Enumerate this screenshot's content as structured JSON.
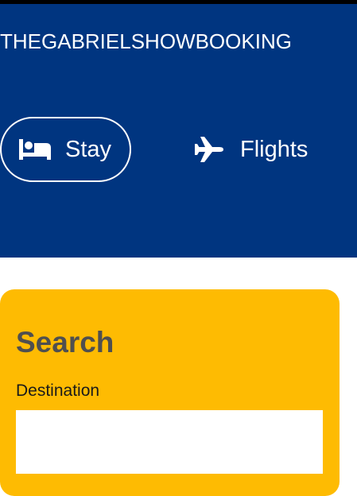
{
  "header": {
    "brand": "THEGABRIELSHOWBOOKING",
    "background_color": "#003580",
    "nav": [
      {
        "label": "Stay",
        "icon": "bed-icon",
        "active": true
      },
      {
        "label": "Flights",
        "icon": "airplane-icon",
        "active": false
      }
    ]
  },
  "search": {
    "title": "Search",
    "destination_label": "Destination",
    "destination_value": "",
    "card_color": "#febb02"
  }
}
